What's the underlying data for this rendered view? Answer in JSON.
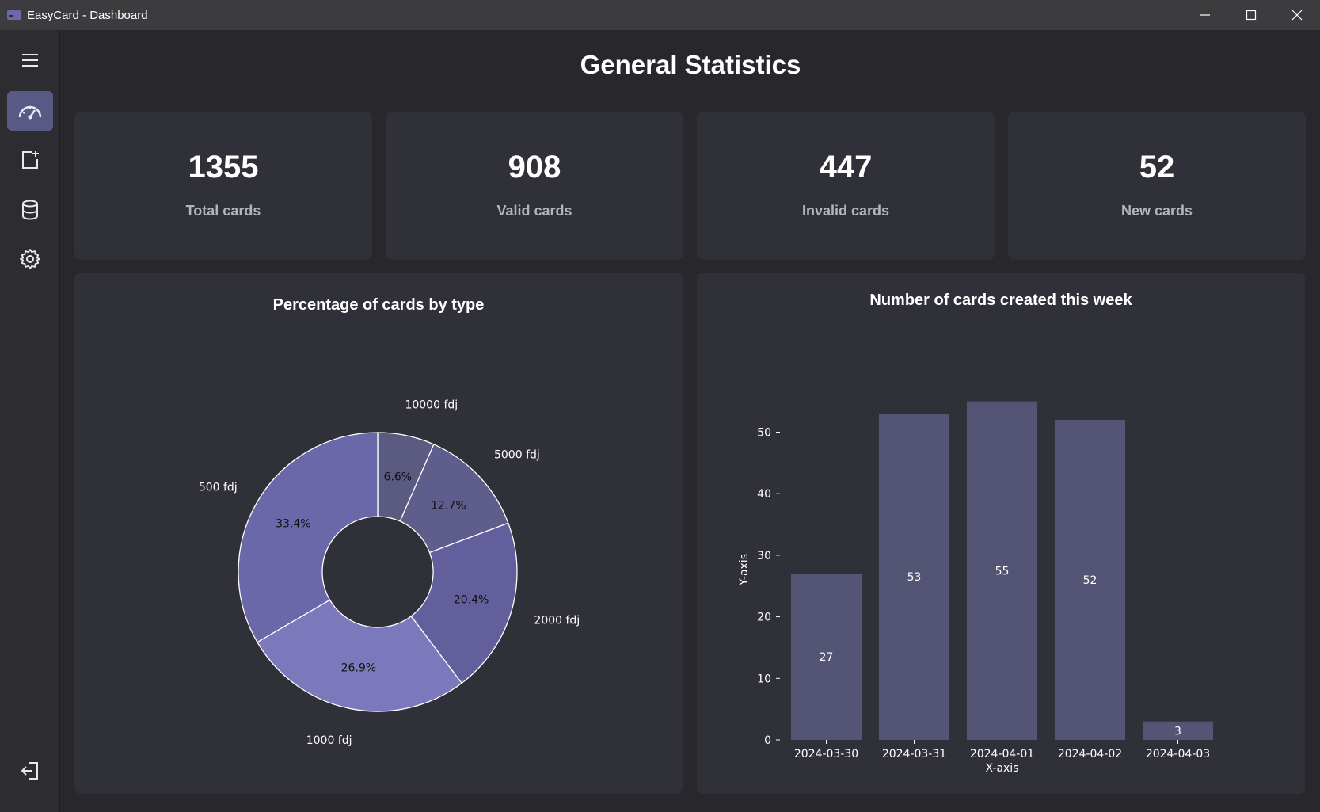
{
  "window": {
    "title": "EasyCard - Dashboard"
  },
  "page": {
    "title": "General Statistics"
  },
  "stats": [
    {
      "value": "1355",
      "label": "Total cards"
    },
    {
      "value": "908",
      "label": "Valid cards"
    },
    {
      "value": "447",
      "label": "Invalid cards"
    },
    {
      "value": "52",
      "label": "New cards"
    }
  ],
  "sidebar": {
    "items": [
      {
        "icon": "menu-icon"
      },
      {
        "icon": "dashboard-icon",
        "active": true
      },
      {
        "icon": "add-card-icon"
      },
      {
        "icon": "database-icon"
      },
      {
        "icon": "settings-icon"
      },
      {
        "icon": "logout-icon"
      }
    ]
  },
  "colors": {
    "accent": "#585a86",
    "bar": "#545474",
    "pie": [
      "#5b5a80",
      "#5f5d8c",
      "#625f9c",
      "#7b79bb",
      "#6a68a8"
    ]
  },
  "chart_data": [
    {
      "type": "pie",
      "title": "Percentage of cards by type",
      "donut": true,
      "categories": [
        "10000 fdj",
        "5000 fdj",
        "2000 fdj",
        "1000 fdj",
        "500 fdj"
      ],
      "values": [
        6.6,
        12.7,
        20.4,
        26.9,
        33.4
      ],
      "value_labels": [
        "6.6%",
        "12.7%",
        "20.4%",
        "26.9%",
        "33.4%"
      ]
    },
    {
      "type": "bar",
      "title": "Number of cards created this week",
      "categories": [
        "2024-03-30",
        "2024-03-31",
        "2024-04-01",
        "2024-04-02",
        "2024-04-03"
      ],
      "values": [
        27,
        53,
        55,
        52,
        3
      ],
      "xlabel": "X-axis",
      "ylabel": "Y-axis",
      "yticks": [
        0,
        10,
        20,
        30,
        40,
        50
      ],
      "ylim": [
        0,
        58
      ],
      "grid": false
    }
  ]
}
